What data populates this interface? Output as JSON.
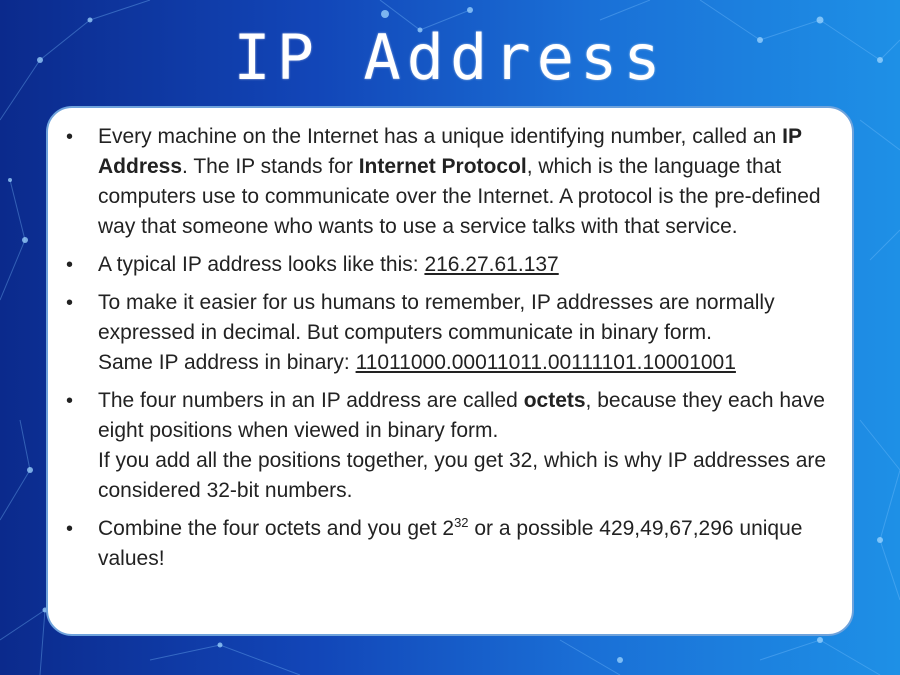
{
  "slide": {
    "title": "IP Address",
    "bullet_char": "•",
    "bullets": [
      {
        "t1": "Every machine on the Internet has a unique identifying number, called an ",
        "b1": "IP Address",
        "t2": ". The IP stands for ",
        "b2": "Internet Protocol",
        "t3": ", which is the language that computers use to communicate over the Internet. A protocol is the pre-defined way that someone who wants to use a service talks with that service."
      },
      {
        "t1": "A typical IP address looks like this: ",
        "ip": "216.27.61.137"
      },
      {
        "t1": "To make it easier for us humans to remember, IP addresses are normally expressed in decimal. But computers communicate in binary form.",
        "t2": "Same IP address in binary: ",
        "binary": "11011000.00011011.00111101.10001001"
      },
      {
        "t1": "The four numbers in an IP address are called ",
        "b1": "octets",
        "t2": ", because they each have eight positions when viewed in binary form.",
        "t3": "If you add all the positions together, you get 32, which is why IP addresses are considered 32-bit numbers."
      },
      {
        "t1": "Combine the four octets and you get 2",
        "sup": "32",
        "t2": " or a possible 429,49,67,296 unique values!"
      }
    ]
  },
  "colors": {
    "bg_dark": "#0b2a8c",
    "bg_light": "#1e90e6",
    "box_border": "#6fa3dc",
    "text": "#222222"
  }
}
